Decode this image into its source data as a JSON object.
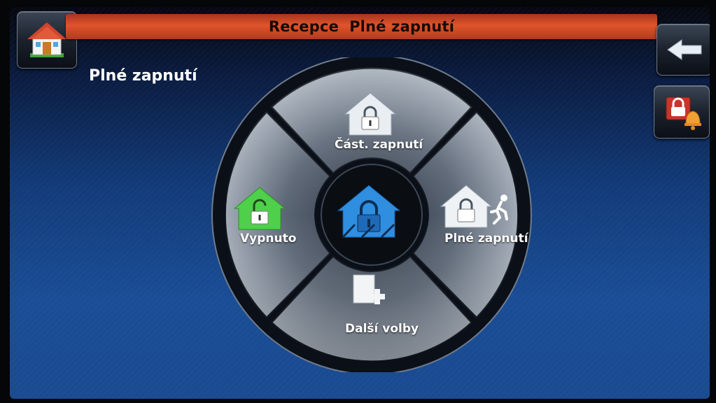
{
  "header": {
    "title": "Recepce  Plné zapnutí"
  },
  "page": {
    "heading": "Plné zapnutí"
  },
  "toolbar": {
    "home_icon": "house-icon",
    "back_icon": "arrow-left-icon",
    "alarm_icon": "lock-bell-icon"
  },
  "dial": {
    "top": {
      "label": "Část. zapnutí",
      "icon": "house-lock-icon"
    },
    "left": {
      "label": "Vypnuto",
      "icon": "house-unlock-icon",
      "color": "#4ed04a"
    },
    "right": {
      "label": "Plné zapnutí",
      "icon": "house-lock-runner-icon"
    },
    "bottom": {
      "label": "Další volby",
      "icon": "page-plus-icon"
    },
    "center": {
      "icon": "house-lock-icon",
      "color": "#2f8ee0"
    }
  },
  "colors": {
    "title_bar": "#e0542a",
    "active_center": "#2f8ee0",
    "off_green": "#4ed04a"
  }
}
